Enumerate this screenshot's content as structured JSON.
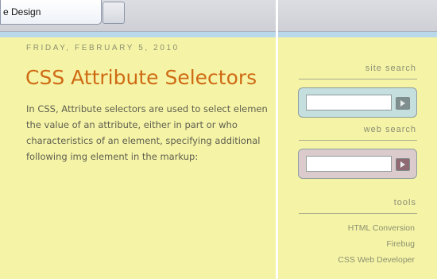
{
  "browser": {
    "tab_title": "e Design"
  },
  "post": {
    "date": "FRIDAY, FEBRUARY 5, 2010",
    "title": "CSS Attribute Selectors",
    "body_lines": [
      "In CSS, Attribute selectors are used to select elemen",
      "the value of an attribute, either in part or who",
      "characteristics of an element, specifying additional",
      "following img element in the markup:"
    ]
  },
  "sidebar": {
    "site_search": {
      "heading": "site search",
      "input_value": "",
      "accent_color": "#c5dede",
      "button_color": "#7f8e8e"
    },
    "web_search": {
      "heading": "web search",
      "input_value": "",
      "accent_color": "#dccbcd",
      "button_color": "#8f6a72"
    },
    "tools": {
      "heading": "tools",
      "links": [
        "HTML Conversion",
        "Firebug",
        "CSS Web Developer"
      ]
    }
  },
  "colors": {
    "page_background": "#f5f4a6",
    "title_orange": "#cf6a14",
    "chrome_strip": "#b9d9ea"
  }
}
